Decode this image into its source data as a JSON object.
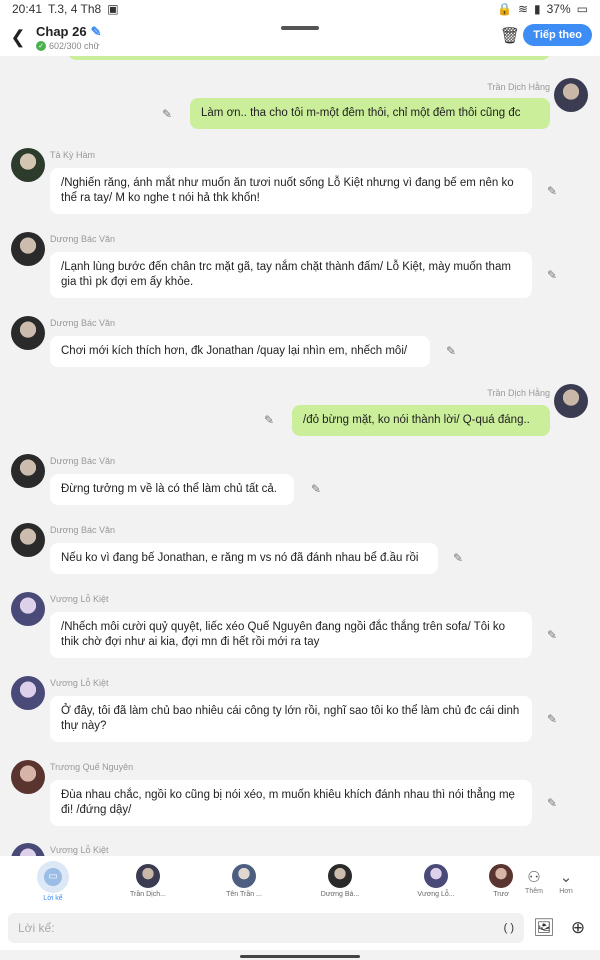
{
  "status_bar": {
    "time": "20:41",
    "date": "T.3, 4 Th8",
    "battery": "37%"
  },
  "header": {
    "title": "Chap 26",
    "word_count": "602/300 chữ",
    "next_label": "Tiếp theo"
  },
  "messages": [
    {
      "side": "right",
      "name": "Trần Dịch Hằng",
      "text": "Làm ơn.. tha cho tôi m-một đêm thôi, chỉ một đêm thôi cũng đc",
      "avatar_color": "#3b3b52"
    },
    {
      "side": "left",
      "name": "Tả Kỳ Hàm",
      "text": "/Nghiến răng, ánh mắt như muốn ăn tươi nuốt sống Lỗ Kiệt nhưng vì đang bế em nên ko thể ra tay/ M ko nghe t nói hả thk khốn!",
      "avatar_color": "#2d3b2d"
    },
    {
      "side": "left",
      "name": "Dương Bác Văn",
      "text": "/Lạnh lùng bước đến chân trc mặt gã, tay nắm chặt thành đấm/ Lỗ Kiệt, mày muốn tham gia thì pk đợi em ấy khỏe.",
      "avatar_color": "#2a2a2a"
    },
    {
      "side": "left",
      "name": "Dương Bác Văn",
      "text": "Chơi mới kích thích hơn, đk Jonathan /quay lại nhìn em, nhếch môi/",
      "avatar_color": "#2a2a2a"
    },
    {
      "side": "right",
      "name": "Trần Dịch Hằng",
      "text": "/đỏ bừng mặt, ko nói thành lời/ Q-quá đáng..",
      "avatar_color": "#3b3b52"
    },
    {
      "side": "left",
      "name": "Dương Bác Văn",
      "text": "Đừng tưởng m về là có thể làm chủ tất cả.",
      "avatar_color": "#2a2a2a"
    },
    {
      "side": "left",
      "name": "Dương Bác Văn",
      "text": "Nếu ko vì đang bế Jonathan, e răng m vs nó đã đánh nhau bể đ.ầu rồi",
      "avatar_color": "#2a2a2a"
    },
    {
      "side": "left",
      "name": "Vương Lỗ Kiệt",
      "text": "/Nhếch môi cười quỷ quyệt, liếc xéo Quế Nguyên đang ngồi đắc thắng trên sofa/ Tôi ko thik chờ đợi như ai kia, đợi mn đi hết rồi mới ra tay",
      "avatar_color": "#4a4a78"
    },
    {
      "side": "left",
      "name": "Vương Lỗ Kiệt",
      "text": "Ở đây, tôi đã làm chủ bao nhiêu cái công ty lớn rồi, nghĩ sao tôi ko thể làm chủ đc cái dinh thự này?",
      "avatar_color": "#4a4a78"
    },
    {
      "side": "left",
      "name": "Trương Quế Nguyên",
      "text": "Đùa nhau chắc, ngồi ko cũng bị nói xéo, m muốn khiêu khích đánh nhau thì nói thẳng mẹ đi! /đứng dậy/",
      "avatar_color": "#5a3530"
    },
    {
      "side": "left",
      "name": "Vương Lỗ Kiệt",
      "text": "",
      "avatar_color": "#4a4a78"
    }
  ],
  "characters_bar": {
    "narrator_label": "Lời kể",
    "characters": [
      {
        "label": "Trần Dịch...",
        "avatar_color": "#3b3b52"
      },
      {
        "label": "Tên Trần ...",
        "avatar_color": "#4d5f80"
      },
      {
        "label": "Dương Bá...",
        "avatar_color": "#2a2a2a"
      },
      {
        "label": "Vương Lỗ...",
        "avatar_color": "#4a4a78"
      },
      {
        "label": "Trươ",
        "avatar_color": "#5a3530"
      }
    ],
    "add_label": "Thêm",
    "more_label": "Hơn"
  },
  "input": {
    "placeholder": "Lời kể:",
    "paren_label": "( )"
  },
  "icons": [
    "back-icon",
    "pencil-icon",
    "trash-icon",
    "edit-icon",
    "image-icon",
    "plus-icon",
    "add-character-icon",
    "chevron-down-icon"
  ]
}
